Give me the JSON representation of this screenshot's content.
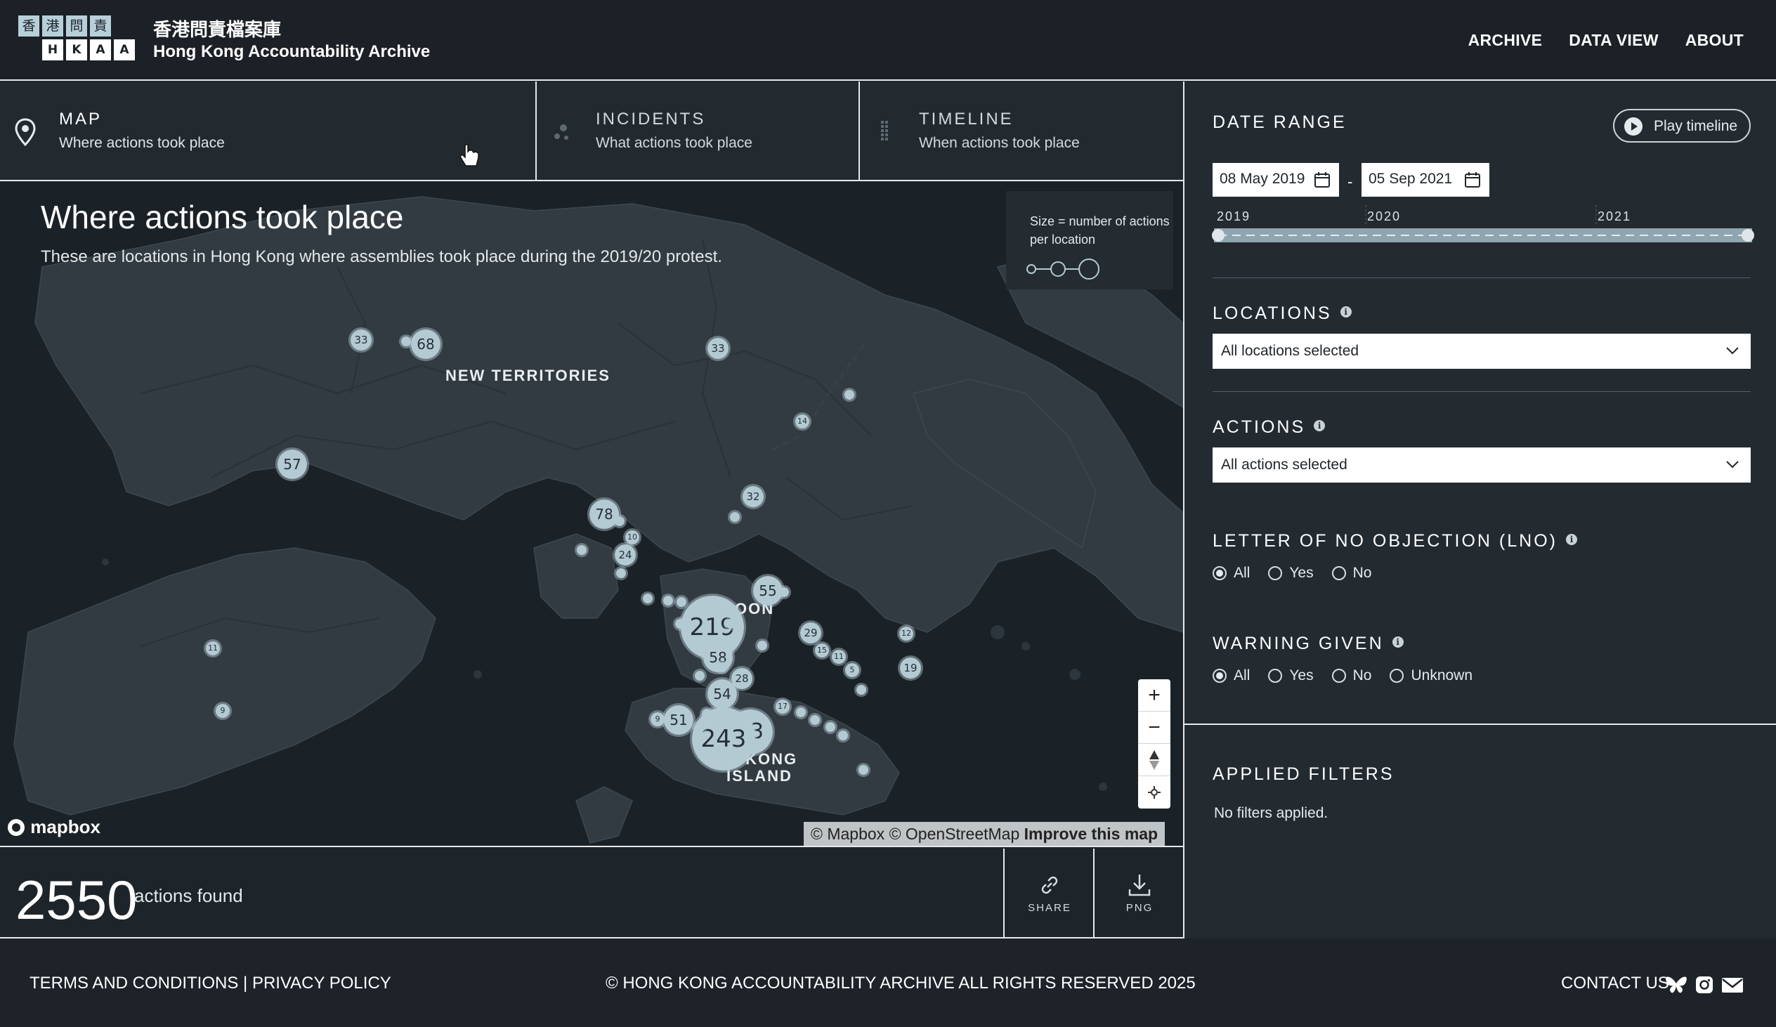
{
  "header": {
    "logo_top": [
      "香",
      "港",
      "問",
      "責"
    ],
    "logo_bottom": [
      "H",
      "K",
      "A",
      "A"
    ],
    "title_zh": "香港問責檔案庫",
    "title_en": "Hong Kong Accountability Archive",
    "nav": [
      "ARCHIVE",
      "DATA VIEW",
      "ABOUT"
    ]
  },
  "tabs": [
    {
      "title": "MAP",
      "subtitle": "Where actions took place",
      "icon": "map-pin-icon",
      "active": true
    },
    {
      "title": "INCIDENTS",
      "subtitle": "What actions took place",
      "icon": "dots-icon",
      "active": false
    },
    {
      "title": "TIMELINE",
      "subtitle": "When actions took place",
      "icon": "timeline-icon",
      "active": false
    }
  ],
  "map": {
    "title": "Where actions took place",
    "description": "These are locations in Hong Kong where assemblies took place during the 2019/20 protest.",
    "legend_text": "Size = number of actions per location",
    "regions": [
      "NEW TERRITORIES",
      "OON",
      "NG KONG",
      "ISLAND"
    ],
    "clusters": [
      {
        "label": "33",
        "size": "m"
      },
      {
        "label": "",
        "size": "xs"
      },
      {
        "label": "68",
        "size": "l"
      },
      {
        "label": "33",
        "size": "m"
      },
      {
        "label": "57",
        "size": "l"
      },
      {
        "label": "14",
        "size": "s"
      },
      {
        "label": "",
        "size": "xs"
      },
      {
        "label": "32",
        "size": "m"
      },
      {
        "label": "",
        "size": "xs"
      },
      {
        "label": "78",
        "size": "l"
      },
      {
        "label": "",
        "size": "xs"
      },
      {
        "label": "10",
        "size": "s"
      },
      {
        "label": "24",
        "size": "m"
      },
      {
        "label": "",
        "size": "xs"
      },
      {
        "label": "",
        "size": "xs"
      },
      {
        "label": "",
        "size": "xs"
      },
      {
        "label": "",
        "size": "xs"
      },
      {
        "label": "55",
        "size": "l"
      },
      {
        "label": "",
        "size": "xs"
      },
      {
        "label": "",
        "size": "xs"
      },
      {
        "label": "219",
        "size": "xxl"
      },
      {
        "label": "",
        "size": "xs"
      },
      {
        "label": "",
        "size": "xs"
      },
      {
        "label": "",
        "size": "xs"
      },
      {
        "label": "58",
        "size": "l"
      },
      {
        "label": "",
        "size": "xs"
      },
      {
        "label": "28",
        "size": "m"
      },
      {
        "label": "",
        "size": "xs"
      },
      {
        "label": "54",
        "size": "l"
      },
      {
        "label": "29",
        "size": "m"
      },
      {
        "label": "15",
        "size": "s"
      },
      {
        "label": "11",
        "size": "s"
      },
      {
        "label": "5",
        "size": "s"
      },
      {
        "label": "",
        "size": "xs"
      },
      {
        "label": "12",
        "size": "s"
      },
      {
        "label": "19",
        "size": "m"
      },
      {
        "label": "11",
        "size": "s"
      },
      {
        "label": "9",
        "size": "s"
      },
      {
        "label": "17",
        "size": "s"
      },
      {
        "label": "",
        "size": "xs"
      },
      {
        "label": "",
        "size": "xs"
      },
      {
        "label": "",
        "size": "xs"
      },
      {
        "label": "",
        "size": "xs"
      },
      {
        "label": "",
        "size": "xs"
      },
      {
        "label": "9",
        "size": "s"
      },
      {
        "label": "51",
        "size": "l"
      },
      {
        "label": "53",
        "size": "xl"
      },
      {
        "label": "243",
        "size": "xxl"
      },
      {
        "label": "",
        "size": "xs"
      },
      {
        "label": "",
        "size": "xs"
      }
    ],
    "zoom_controls": [
      "+",
      "−",
      "compass",
      "locate"
    ],
    "attribution": [
      "© Mapbox",
      "© OpenStreetMap",
      "Improve this map"
    ],
    "mapbox_label": "mapbox"
  },
  "results": {
    "count": "2550",
    "label": "actions found",
    "share_label": "SHARE",
    "png_label": "PNG"
  },
  "filters": {
    "date_range": {
      "title": "DATE RANGE",
      "play_label": "Play timeline",
      "start": "08 May 2019",
      "end": "05 Sep 2021",
      "separator": "-",
      "years": [
        "2019",
        "2020",
        "2021"
      ]
    },
    "locations": {
      "title": "LOCATIONS",
      "value": "All locations selected"
    },
    "actions": {
      "title": "ACTIONS",
      "value": "All actions selected"
    },
    "lno": {
      "title": "LETTER OF NO OBJECTION (LNO)",
      "options": [
        "All",
        "Yes",
        "No"
      ],
      "selected": "All"
    },
    "warning": {
      "title": "WARNING GIVEN",
      "options": [
        "All",
        "Yes",
        "No",
        "Unknown"
      ],
      "selected": "All"
    },
    "applied": {
      "title": "APPLIED FILTERS",
      "text": "No filters applied."
    }
  },
  "footer": {
    "terms": "TERMS AND CONDITIONS",
    "separator": "|",
    "privacy": "PRIVACY POLICY",
    "copyright": "© HONG KONG ACCOUNTABILITY ARCHIVE ALL RIGHTS RESERVED 2025",
    "contact": "CONTACT US",
    "social_icons": [
      "bluesky-icon",
      "instagram-icon",
      "mail-icon"
    ]
  },
  "colors": {
    "background": "#1d2328",
    "panel": "#232b31",
    "cluster": "#b4cad3",
    "accent": "#b7cfd9"
  }
}
